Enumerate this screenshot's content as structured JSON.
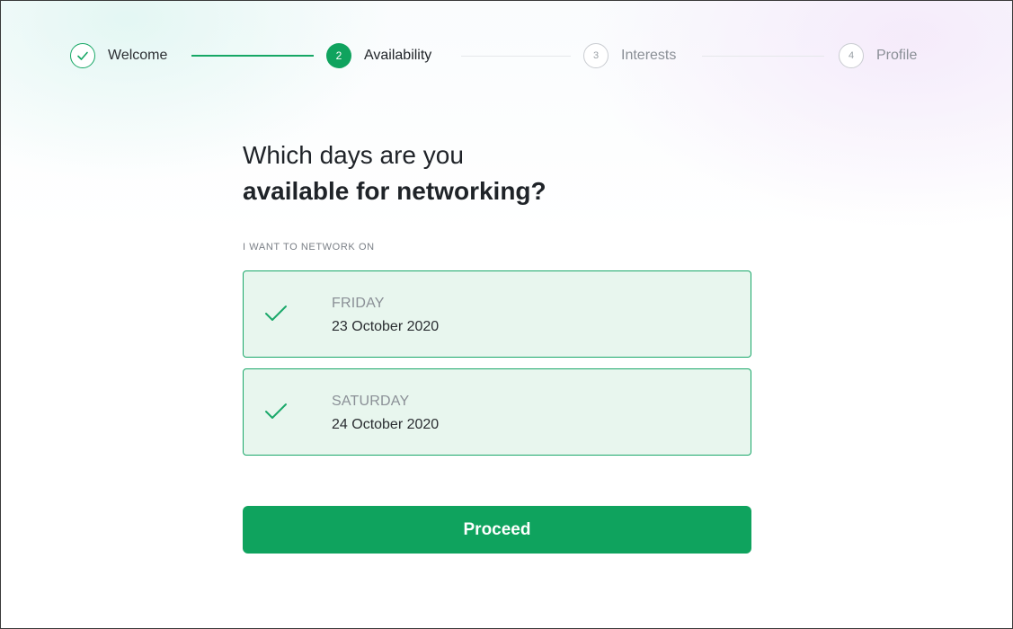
{
  "stepper": {
    "steps": [
      {
        "number": "",
        "label": "Welcome",
        "state": "done",
        "icon": "check-icon"
      },
      {
        "number": "2",
        "label": "Availability",
        "state": "active"
      },
      {
        "number": "3",
        "label": "Interests",
        "state": "pending"
      },
      {
        "number": "4",
        "label": "Profile",
        "state": "pending"
      }
    ]
  },
  "main": {
    "title_line1": "Which days are you",
    "title_line2": "available for networking?",
    "section_label": "I WANT TO NETWORK ON",
    "days": [
      {
        "day": "FRIDAY",
        "date": "23 October 2020",
        "selected": true,
        "icon": "checkmark-icon"
      },
      {
        "day": "SATURDAY",
        "date": "24 October 2020",
        "selected": true,
        "icon": "checkmark-icon"
      }
    ],
    "proceed_label": "Proceed"
  },
  "colors": {
    "accent": "#0fa35e",
    "card_bg": "#e8f6ee",
    "card_border": "#1aa86a",
    "muted": "#8a8f96"
  }
}
